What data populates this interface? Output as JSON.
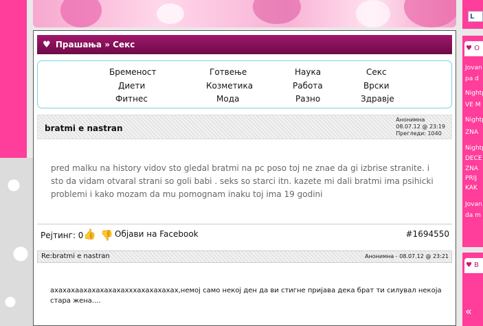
{
  "breadcrumb": {
    "section": "Прашања",
    "sep": "»",
    "category": "Секс"
  },
  "categories": [
    [
      "Бременост",
      "Готвење",
      "Наука",
      "Секс"
    ],
    [
      "Диети",
      "Козметика",
      "Работа",
      "Врски"
    ],
    [
      "Фитнес",
      "Мода",
      "Разно",
      "Здравје"
    ]
  ],
  "post": {
    "title": "bratmi e nastran",
    "author": "Анонимна",
    "date": "08.07.12 @ 23:19",
    "views": "Прегледи: 1040",
    "body": "pred malku na history vidov sto gledal bratmi na pc poso toj ne znae da gi izbrise stranite.  i sto da vidam otvaral strani so goli babi .  seks so starci  itn.  kazete mi dali bratmi ima psihicki problemi  i kako mozam da mu pomognam   inaku toj ima 19 godini",
    "rating_label": "Рејтинг: 0",
    "share_label": "Објави на Facebook",
    "id": "#1694550"
  },
  "reply": {
    "title": "Re:bratmi e nastran",
    "meta": "Анонимна - 08.07.12 @ 23:21",
    "body": "ахахахаахахахахахахххахахахахах,немој само некој ден да ви стигне пријава дека брат ти силувал некоја стара жена...."
  },
  "facebook": {
    "like": "L"
  },
  "sidebar": {
    "block1_head": "О",
    "block1_links": [
      "Jovan",
      "pa d",
      "Nightp",
      "VE M",
      "Nightp",
      "ZNA",
      "Nightp",
      "DECE",
      "ZNA",
      "PRIJ",
      "KAK",
      "Jovan",
      "da m"
    ],
    "block2_head": "В",
    "block2_arrow": "«"
  },
  "colors": {
    "accent": "#ff3d9a",
    "title_bar": "#8a1058",
    "cat_border": "#7ad0e6"
  }
}
